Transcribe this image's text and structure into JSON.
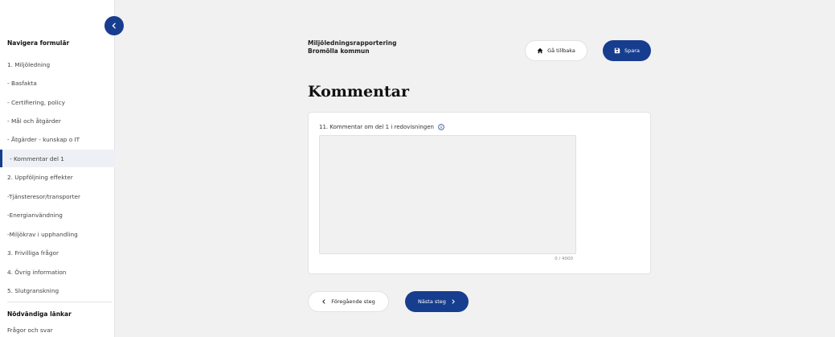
{
  "sidebar": {
    "heading": "Navigera formulär",
    "items": [
      {
        "label": "1. Miljöledning"
      },
      {
        "label": "- Basfakta"
      },
      {
        "label": "- Certifiering, policy"
      },
      {
        "label": "- Mål och åtgärder"
      },
      {
        "label": "- Åtgärder - kunskap o IT"
      },
      {
        "label": "- Kommentar del 1",
        "active": true
      },
      {
        "label": "2. Uppföljning effekter"
      },
      {
        "label": "-Tjänsteresor/transporter"
      },
      {
        "label": "-Energianvändning"
      },
      {
        "label": "-Miljökrav i upphandling"
      },
      {
        "label": "3. Frivilliga frågor"
      },
      {
        "label": "4. Övrig information"
      },
      {
        "label": "5. Slutgranskning"
      }
    ],
    "links_heading": "Nödvändiga länkar",
    "links": [
      {
        "label": "Frågor och svar"
      }
    ]
  },
  "header": {
    "form_name": "Miljöledningsrapportering",
    "organization": "Bromölla kommun",
    "back_label": "Gå tillbaka",
    "save_label": "Spara"
  },
  "main": {
    "title": "Kommentar",
    "field_label": "11. Kommentar om del 1 i redovisningen",
    "field_value": "",
    "char_count": "0 / 4000"
  },
  "navigation": {
    "prev_label": "Föregående steg",
    "next_label": "Nästa steg"
  },
  "colors": {
    "accent": "#173d8f",
    "background": "#f1f1f1"
  }
}
